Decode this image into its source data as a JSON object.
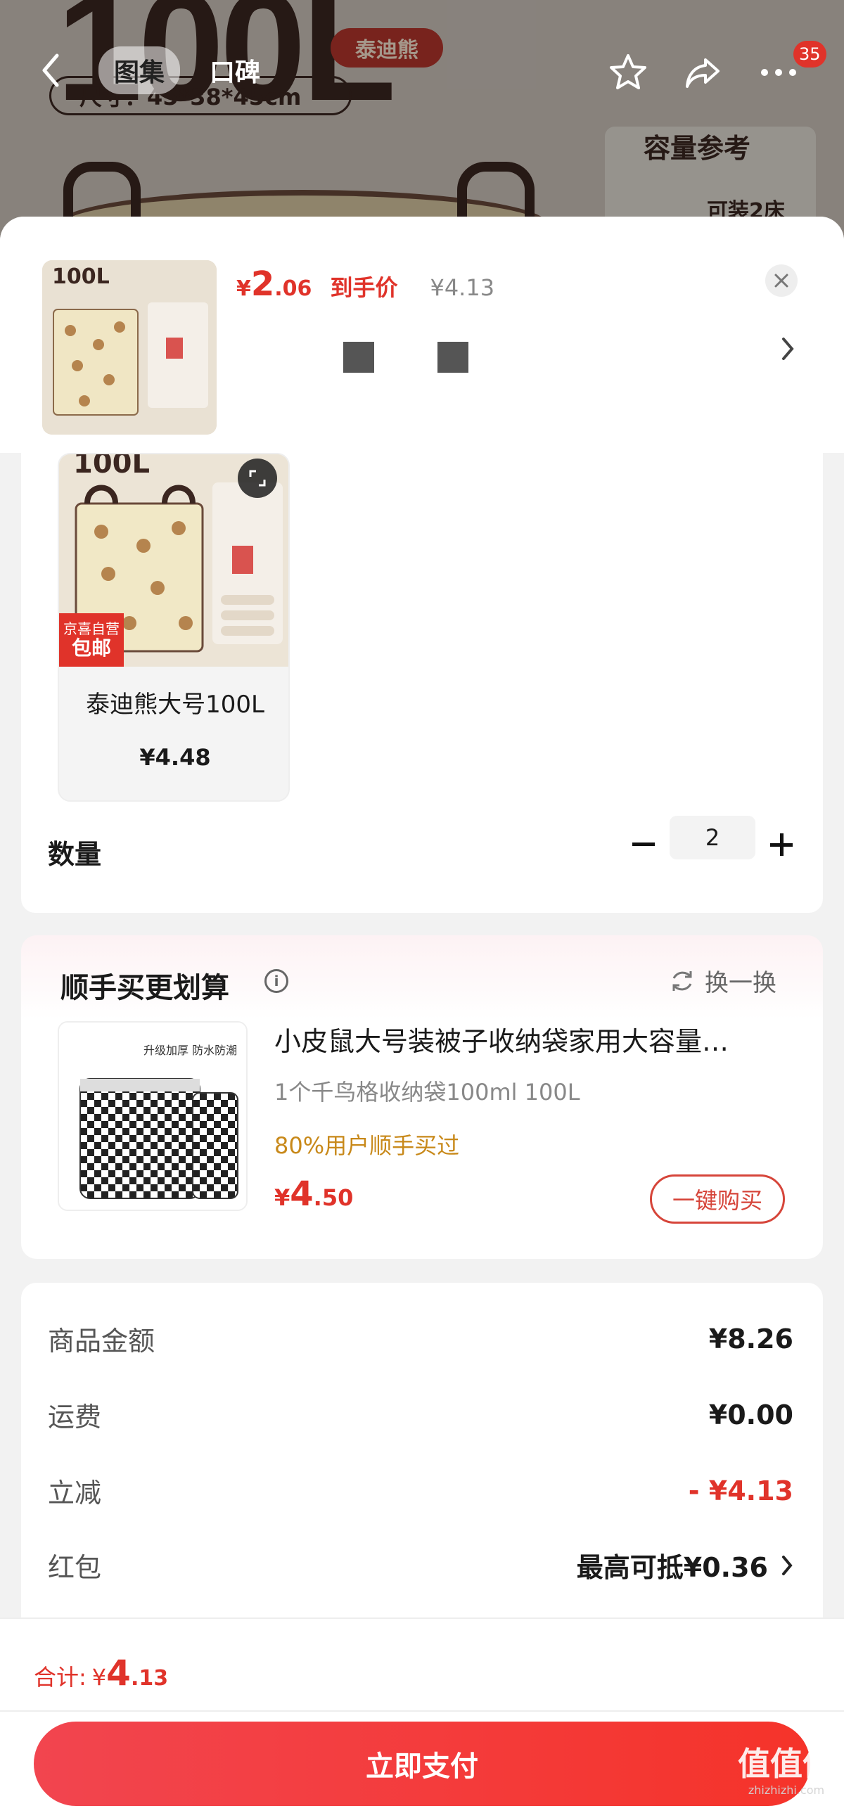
{
  "background": {
    "big_text": "100L",
    "brand": "泰迪熊",
    "size_text": "尺寸：45*38*45cm",
    "capacity_title": "容量参考",
    "capacity_sub": "可装2床"
  },
  "nav": {
    "tabs": [
      {
        "label": "图集",
        "active": true
      },
      {
        "label": "口碑",
        "active": false
      }
    ],
    "cart_badge": "35"
  },
  "sheet_header": {
    "price": {
      "yen": "¥",
      "int": "2",
      "dec": ".06"
    },
    "price_label": "到手价",
    "original_price": "¥4.13",
    "thumb_text": "100L"
  },
  "spec": {
    "card_name": "泰迪熊大号100L",
    "card_price": "¥4.48",
    "tag_line1": "京喜自营",
    "tag_line2": "包邮",
    "img_text": "100L"
  },
  "quantity": {
    "label": "数量",
    "value": "2"
  },
  "upsell": {
    "title": "顺手买更划算",
    "swap_label": "换一换",
    "product_name": "小皮鼠大号装被子收纳袋家用大容量…",
    "product_spec": "1个千鸟格收纳袋100ml    100L",
    "social": "80%用户顺手买过",
    "price": {
      "yen": "¥",
      "int": "4",
      "dec": ".50"
    },
    "buy_label": "一键购买",
    "thumb_caption": "升级加厚 防水防潮"
  },
  "summary": {
    "rows": [
      {
        "label": "商品金额",
        "value": "¥8.26"
      },
      {
        "label": "运费",
        "value": "¥0.00"
      },
      {
        "label": "立减",
        "value": "- ¥4.13"
      },
      {
        "label": "红包",
        "value": "最高可抵¥0.36"
      }
    ]
  },
  "footer": {
    "total_label": "合计:",
    "total_yen": "¥",
    "total_int": "4",
    "total_dec": ".13",
    "pay_label": "立即支付"
  },
  "watermark": {
    "main": "值值值",
    "sub": "zhizhizhi.com"
  },
  "colors": {
    "accent_red": "#e0332a",
    "social_orange": "#c8891a"
  }
}
